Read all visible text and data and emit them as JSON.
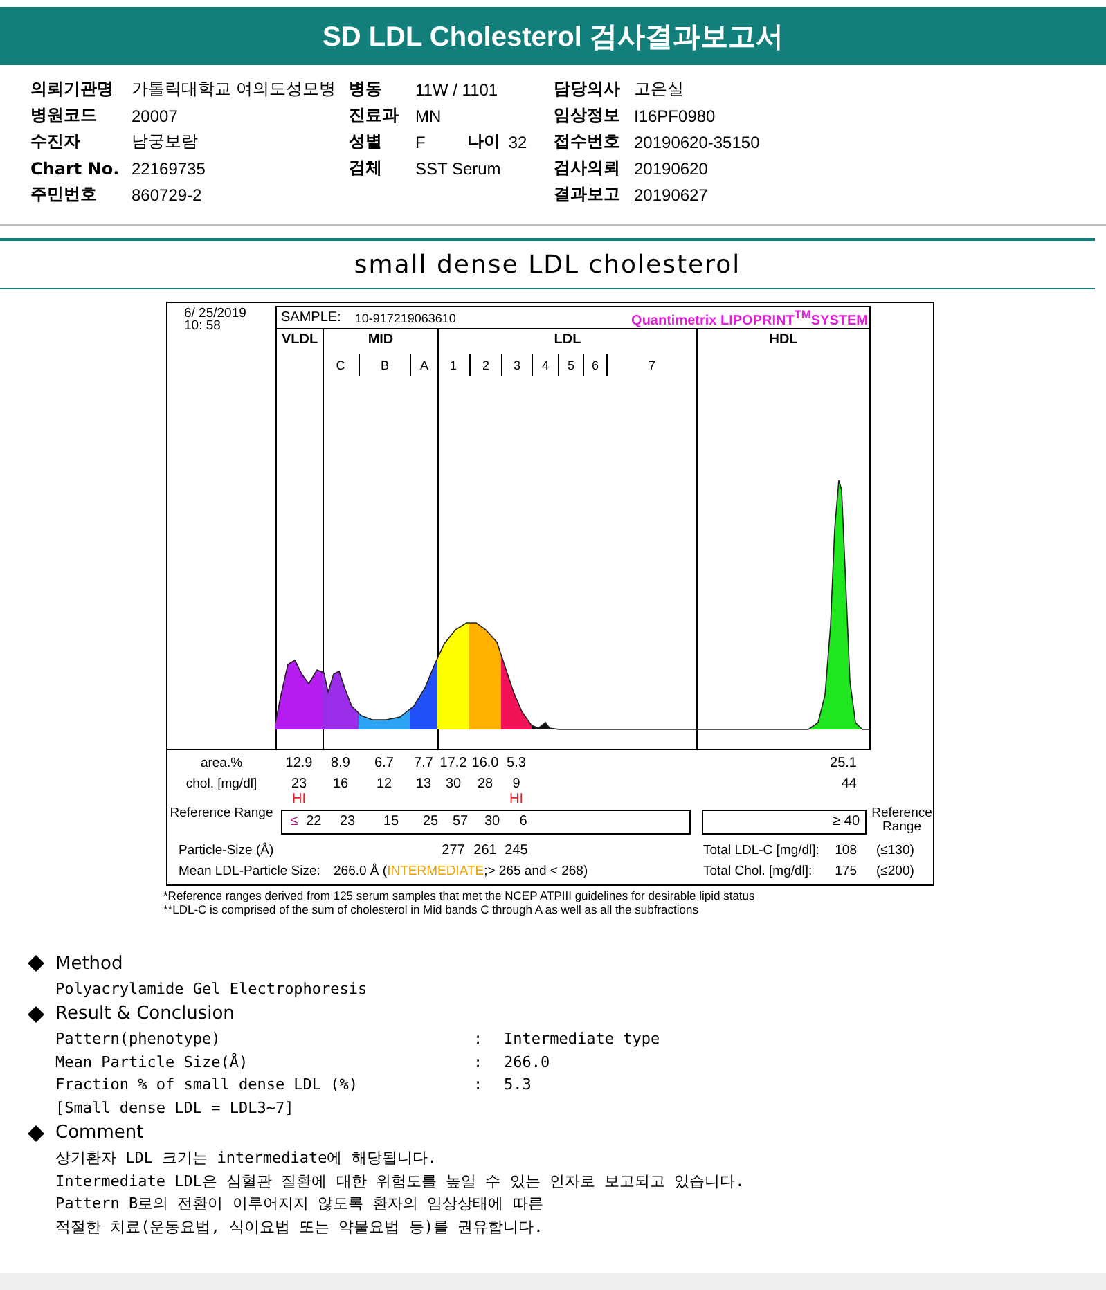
{
  "report_title": "SD LDL Cholesterol 검사결과보고서",
  "info_rows": [
    {
      "left": [
        {
          "label": "의뢰기관명",
          "value": "가톨릭대학교 여의도성모병"
        }
      ],
      "middle": [
        {
          "label": "병동",
          "value": "11W / 1101"
        }
      ],
      "right": [
        {
          "label": "담당의사",
          "value": "고은실"
        }
      ]
    },
    {
      "left": [
        {
          "label": "병원코드",
          "value": "20007"
        }
      ],
      "middle": [
        {
          "label": "진료과",
          "value": "MN"
        }
      ],
      "right": [
        {
          "label": "임상정보",
          "value": "I16PF0980"
        }
      ]
    },
    {
      "left": [
        {
          "label": "수진자",
          "value": "남궁보람"
        }
      ],
      "middle": [
        {
          "label": "성별",
          "value": "F"
        },
        {
          "label": "나이",
          "value": "32"
        }
      ],
      "right": [
        {
          "label": "접수번호",
          "value": "20190620-35150"
        }
      ]
    },
    {
      "left": [
        {
          "label": "Chart No.",
          "value": "22169735"
        }
      ],
      "middle": [
        {
          "label": "검체",
          "value": "SST Serum"
        }
      ],
      "right": [
        {
          "label": "검사의뢰",
          "value": "20190620"
        }
      ]
    },
    {
      "left": [
        {
          "label": "주민번호",
          "value": "860729-2"
        }
      ],
      "right": [
        {
          "label": "결과보고",
          "value": "20190627"
        }
      ]
    }
  ],
  "section_title": "small dense LDL cholesterol",
  "lipoprint": {
    "date": "6/ 25/2019",
    "time": "10: 58",
    "sample_label": "SAMPLE:",
    "sample_id": "10-917219063610",
    "system": "Quantimetrix LIPOPRINT$^{TM}$SYSTEM",
    "bands": [
      {
        "name": "VLDL"
      },
      {
        "name": "MID",
        "subbands": [
          "C",
          "B",
          "A"
        ]
      },
      {
        "name": "LDL",
        "subbands": [
          "1",
          "2",
          "3",
          "4",
          "5",
          "6",
          "7"
        ]
      },
      {
        "name": "HDL"
      }
    ],
    "area_row": {
      "label": "area.%",
      "values": [
        "12.9",
        "8.9",
        "6.7",
        "7.7",
        "17.2",
        "16.0",
        "5.3"
      ],
      "hdl": "25.1"
    },
    "chol_row": {
      "label": "chol. [mg/dl]",
      "cells": [
        {
          "value": "23",
          "flag": "HI"
        },
        {
          "value": "16"
        },
        {
          "value": "12"
        },
        {
          "value": "13"
        },
        {
          "value": "30"
        },
        {
          "value": "28"
        },
        {
          "value": "9",
          "flag": "HI"
        }
      ],
      "hdl": "44"
    },
    "reference_row": {
      "label": "Reference Range",
      "prefix": "≤",
      "values": [
        "22",
        "23",
        "15",
        "25",
        "57",
        "30",
        "6"
      ],
      "hdl": "≥ 40",
      "right_label": "Reference Range"
    },
    "particle_row": {
      "label": "Particle-Size (Å)",
      "ldl_values": [
        "277",
        "261",
        "245"
      ]
    },
    "total_ldl": {
      "label": "Total LDL-C [mg/dl]:",
      "value": "108",
      "limit": "(≤130)"
    },
    "total_chol": {
      "label": "Total Chol. [mg/dl]:",
      "value": "175",
      "limit": "(≤200)"
    },
    "mean_size": {
      "label": "Mean LDL-Particle Size:",
      "value": "266.0 Å",
      "note_before": "(",
      "category": "INTERMEDIATE",
      "note_after": ";> 265 and < 268)"
    }
  },
  "footnotes": [
    "*Reference ranges derived from 125 serum samples that met the NCEP ATPIII guidelines for desirable lipid status",
    "**LDL-C is comprised of the sum of cholesterol in Mid bands C through A as well as all the subfractions"
  ],
  "sections": [
    {
      "heading": "Method",
      "lines": [
        {
          "kind": "text",
          "text": "Polyacrylamide Gel Electrophoresis"
        }
      ]
    },
    {
      "heading": "Result & Conclusion",
      "lines": [
        {
          "kind": "pair",
          "label": "Pattern(phenotype)",
          "separator": ":",
          "value": "Intermediate type"
        },
        {
          "kind": "pair",
          "label": "Mean Particle Size(Å)",
          "separator": ":",
          "value": "266.0"
        },
        {
          "kind": "pair",
          "label": "Fraction % of small dense LDL (%)",
          "separator": ":",
          "value": "5.3"
        },
        {
          "kind": "text",
          "text": "[Small dense LDL = LDL3~7]"
        }
      ]
    },
    {
      "heading": "Comment",
      "lines": [
        {
          "kind": "text",
          "text": "상기환자 LDL 크기는 intermediate에 해당됩니다."
        },
        {
          "kind": "text",
          "text": "Intermediate LDL은 심혈관 질환에 대한 위험도를 높일 수 있는 인자로 보고되고 있습니다."
        },
        {
          "kind": "text",
          "text": "Pattern B로의 전환이 이루어지지 않도록 환자의 임상상태에 따른"
        },
        {
          "kind": "text",
          "text": "적절한 치료(운동요법, 식이요법 또는 약물요법 등)를 권유합니다."
        }
      ]
    }
  ]
}
